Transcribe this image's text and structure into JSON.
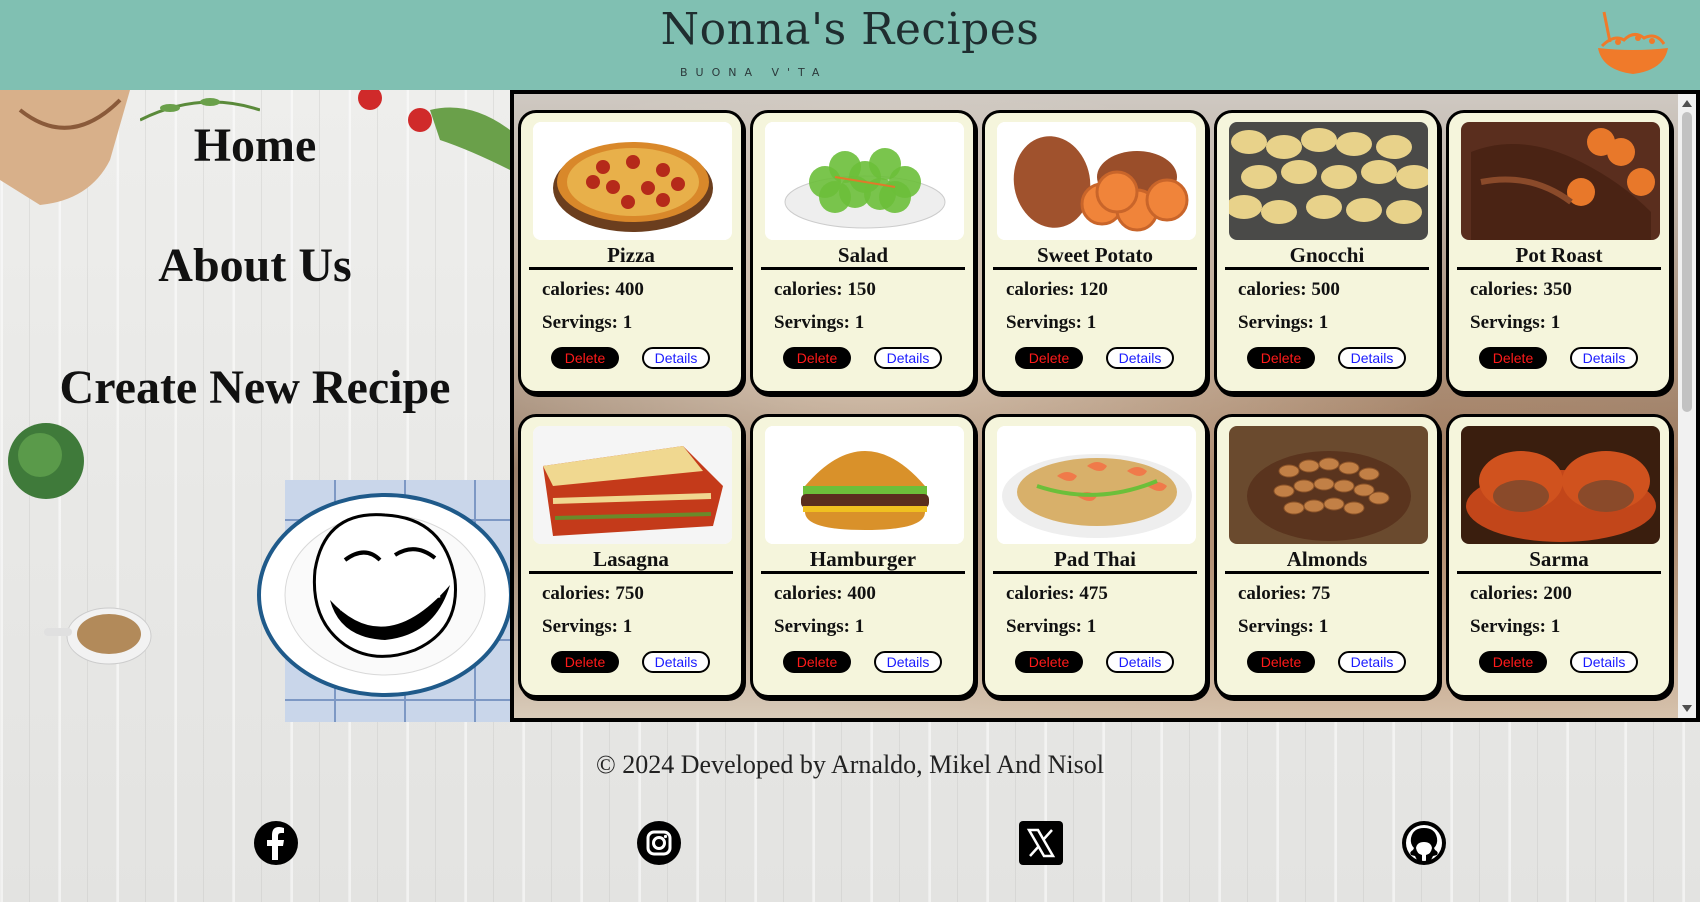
{
  "header": {
    "title": "Nonna's Recipes",
    "subtitle": "BUONA V'TA",
    "logo_icon": "bowl-logo-icon",
    "bg_color": "#80c0b2"
  },
  "nav": {
    "home": "Home",
    "about": "About Us",
    "create": "Create New Recipe"
  },
  "recipes": [
    {
      "name": "Pizza",
      "calories": "calories: 400",
      "servings": "Servings: 1",
      "delete": "Delete",
      "details": "Details",
      "image": "pizza"
    },
    {
      "name": "Salad",
      "calories": "calories: 150",
      "servings": "Servings: 1",
      "delete": "Delete",
      "details": "Details",
      "image": "salad"
    },
    {
      "name": "Sweet Potato",
      "calories": "calories: 120",
      "servings": "Servings: 1",
      "delete": "Delete",
      "details": "Details",
      "image": "sweet-potato"
    },
    {
      "name": "Gnocchi",
      "calories": "calories: 500",
      "servings": "Servings: 1",
      "delete": "Delete",
      "details": "Details",
      "image": "gnocchi"
    },
    {
      "name": "Pot Roast",
      "calories": "calories: 350",
      "servings": "Servings: 1",
      "delete": "Delete",
      "details": "Details",
      "image": "pot-roast"
    },
    {
      "name": "Lasagna",
      "calories": "calories: 750",
      "servings": "Servings: 1",
      "delete": "Delete",
      "details": "Details",
      "image": "lasagna"
    },
    {
      "name": "Hamburger",
      "calories": "calories: 400",
      "servings": "Servings: 1",
      "delete": "Delete",
      "details": "Details",
      "image": "hamburger"
    },
    {
      "name": "Pad Thai",
      "calories": "calories: 475",
      "servings": "Servings: 1",
      "delete": "Delete",
      "details": "Details",
      "image": "pad-thai"
    },
    {
      "name": "Almonds",
      "calories": "calories: 75",
      "servings": "Servings: 1",
      "delete": "Delete",
      "details": "Details",
      "image": "almonds"
    },
    {
      "name": "Sarma",
      "calories": "calories: 200",
      "servings": "Servings: 1",
      "delete": "Delete",
      "details": "Details",
      "image": "sarma"
    }
  ],
  "footer": {
    "copyright": "© 2024 Developed by Arnaldo, Mikel And Nisol",
    "social": [
      "facebook-icon",
      "instagram-icon",
      "x-twitter-icon",
      "github-icon"
    ]
  },
  "colors": {
    "card_bg": "#f5f5dc",
    "delete_text": "#ff1a1a",
    "details_text": "#1a1aff"
  }
}
